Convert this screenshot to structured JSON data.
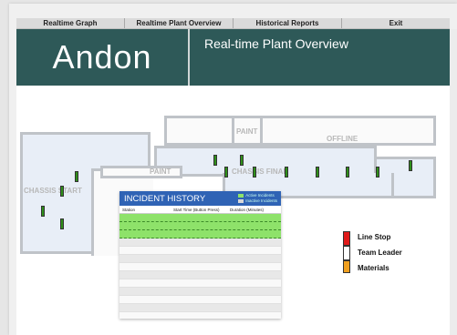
{
  "menu": [
    {
      "label": "Realtime Graph"
    },
    {
      "label": "Realtime Plant Overview"
    },
    {
      "label": "Historical Reports"
    },
    {
      "label": "Exit"
    }
  ],
  "header": {
    "brand": "Andon",
    "title": "Real-time Plant Overview"
  },
  "zones": {
    "paint_top": "PAINT",
    "offline": "OFFLINE",
    "paint_bottom": "PAINT",
    "chassis_final": "CHASSIS FINAL",
    "chassis_start": "CHASSIS START"
  },
  "incident_history": {
    "title": "INCIDENT HISTORY",
    "legend_active": "Active Incidents",
    "legend_inactive": "Inactive Incidents",
    "columns": [
      "Station",
      "Start Time (Button Press)",
      "Duration (Minutes)"
    ],
    "active_color": "#8ee26a",
    "inactive_color": "#d8d8d8"
  },
  "legend": {
    "line_stop": {
      "label": "Line Stop",
      "color": "#e01a1a"
    },
    "team_leader": {
      "label": "Team Leader",
      "color": "#ffffff"
    },
    "materials": {
      "label": "Materials",
      "color": "#f0a020"
    }
  },
  "colors": {
    "header_bg": "#2e5958",
    "andon_green": "#2f8f1a",
    "incident_header": "#2f63b5"
  }
}
